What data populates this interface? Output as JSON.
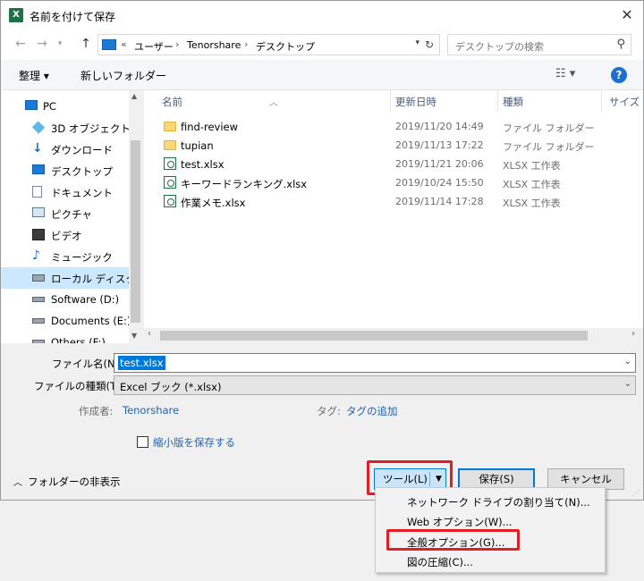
{
  "window": {
    "title": "名前を付けて保存",
    "app_icon_letter": "X",
    "close_glyph": "✕"
  },
  "address": {
    "prefix": "«",
    "path": [
      "ユーザー",
      "Tenorshare",
      "デスクトップ"
    ],
    "search_placeholder": "デスクトップの検索"
  },
  "toolbar": {
    "organize_label": "整理 ▾",
    "new_folder_label": "新しいフォルダー"
  },
  "nav": {
    "items": [
      {
        "label": "PC"
      },
      {
        "label": "3D オブジェクト"
      },
      {
        "label": "ダウンロード"
      },
      {
        "label": "デスクトップ"
      },
      {
        "label": "ドキュメント"
      },
      {
        "label": "ピクチャ"
      },
      {
        "label": "ビデオ"
      },
      {
        "label": "ミュージック"
      },
      {
        "label": "ローカル ディスク (C"
      },
      {
        "label": "Software (D:)"
      },
      {
        "label": "Documents (E:)"
      },
      {
        "label": "Others (F:)"
      }
    ]
  },
  "filelist": {
    "columns": [
      "名前",
      "更新日時",
      "種類",
      "サイズ"
    ],
    "rows": [
      {
        "name": "find-review",
        "date": "2019/11/20 14:49",
        "type": "ファイル フォルダー",
        "kind": "folder"
      },
      {
        "name": "tupian",
        "date": "2019/11/13 17:22",
        "type": "ファイル フォルダー",
        "kind": "folder"
      },
      {
        "name": "test.xlsx",
        "date": "2019/11/21 20:06",
        "type": "XLSX 工作表",
        "kind": "xlsx"
      },
      {
        "name": "キーワードランキング.xlsx",
        "date": "2019/10/24 15:50",
        "type": "XLSX 工作表",
        "kind": "xlsx"
      },
      {
        "name": "作業メモ.xlsx",
        "date": "2019/11/14 17:28",
        "type": "XLSX 工作表",
        "kind": "xlsx"
      }
    ]
  },
  "form": {
    "filename_label": "ファイル名(N):",
    "filename_value": "test.xlsx",
    "filetype_label": "ファイルの種類(T):",
    "filetype_value": "Excel ブック (*.xlsx)",
    "author_label": "作成者:",
    "author_value": "Tenorshare",
    "tags_label": "タグ:",
    "tags_value": "タグの追加",
    "thumbnail_label": "縮小版を保存する"
  },
  "footer": {
    "hide_folders_label": "フォルダーの非表示",
    "tools_label": "ツール(L)",
    "save_label": "保存(S)",
    "cancel_label": "キャンセル"
  },
  "tools_menu": {
    "items": [
      {
        "label": "ネットワーク ドライブの割り当て(N)..."
      },
      {
        "label": "Web オプション(W)..."
      },
      {
        "label": "全般オプション(G)..."
      },
      {
        "label": "図の圧縮(C)..."
      }
    ]
  },
  "colors": {
    "accent": "#0078d7",
    "highlight_red": "#e51c23",
    "link": "#1c63b6",
    "nav_selected": "#cce8ff"
  }
}
